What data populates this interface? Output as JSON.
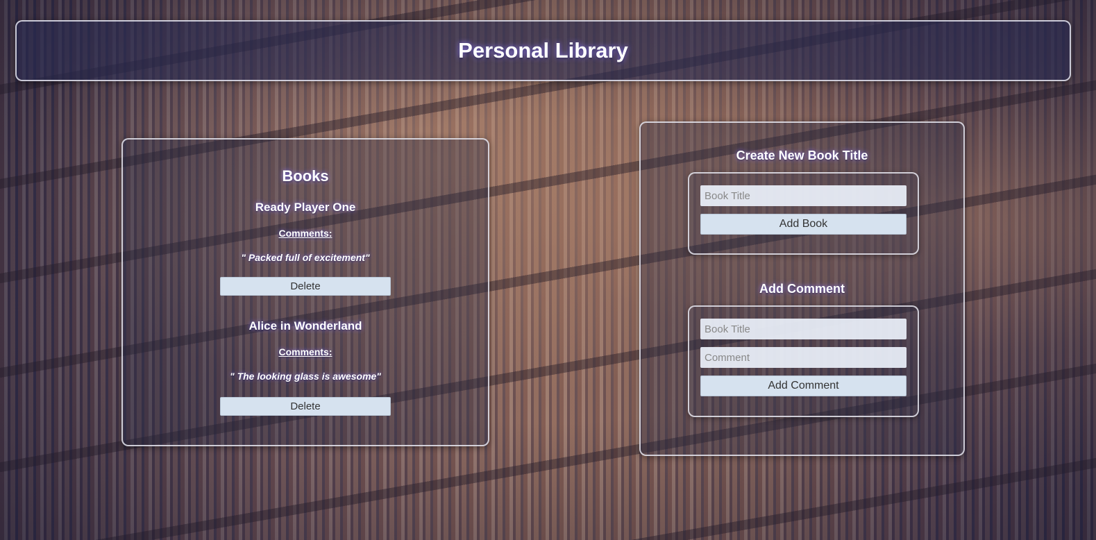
{
  "header": {
    "title": "Personal Library"
  },
  "books": {
    "title": "Books",
    "items": [
      {
        "title": "Ready Player One",
        "comments_label": "Comments:",
        "comments": [
          "\" Packed full of excitement\""
        ],
        "delete_label": "Delete"
      },
      {
        "title": "Alice in Wonderland",
        "comments_label": "Comments:",
        "comments": [
          "\" The looking glass is awesome\""
        ],
        "delete_label": "Delete"
      }
    ]
  },
  "create_book": {
    "title": "Create New Book Title",
    "book_title_placeholder": "Book Title",
    "book_title_value": "",
    "submit_label": "Add Book"
  },
  "add_comment": {
    "title": "Add Comment",
    "book_title_placeholder": "Book Title",
    "book_title_value": "",
    "comment_placeholder": "Comment",
    "comment_value": "",
    "submit_label": "Add Comment"
  }
}
